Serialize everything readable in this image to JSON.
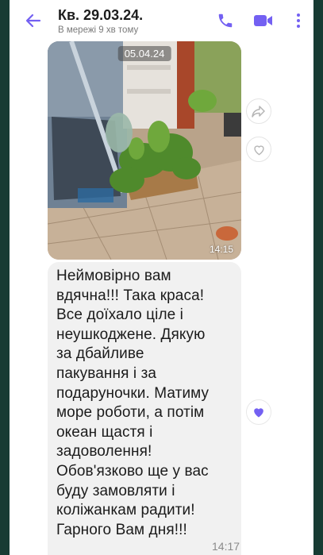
{
  "header": {
    "title": "Кв. 29.03.24.",
    "status": "В мережі 9 хв тому"
  },
  "photo_message": {
    "date": "05.04.24",
    "time": "14:15"
  },
  "text_message": {
    "text": "Неймовірно вам\nвдячна!!! Така краса!\nВсе доїхало ціле і\nнеушкоджене. Дякую\nза дбайливе\nпакування і за\nподаруночки. Матиму\nморе роботи, а потім\nокеан щастя і\nзадоволення!\nОбов'язково ще у вас\nбуду замовляти і\nколіжанкам радити!\nГарного Вам дня!!!",
    "time": "14:17"
  },
  "colors": {
    "accent": "#7360f2",
    "bubble": "#f1f1f1",
    "frame": "#173b33"
  },
  "icons": [
    "back-arrow-icon",
    "phone-icon",
    "video-camera-icon",
    "more-vertical-icon",
    "share-icon",
    "heart-outline-icon",
    "heart-filled-icon"
  ]
}
